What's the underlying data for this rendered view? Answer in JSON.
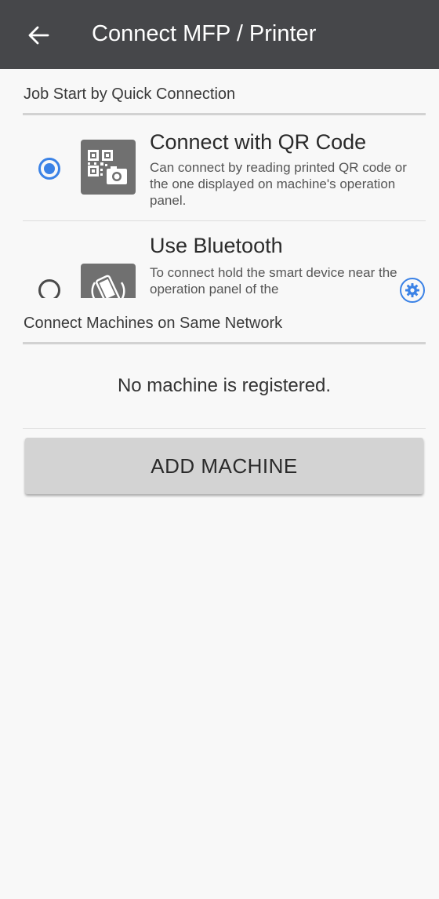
{
  "app_bar": {
    "title": "Connect MFP / Printer",
    "back_icon": "arrow-left-icon"
  },
  "quick_connection": {
    "header": "Job Start by Quick Connection",
    "options": [
      {
        "title": "Connect with QR Code",
        "description": "Can connect by reading printed QR code or the one displayed on machine's operation panel.",
        "icon": "qr-code-camera-icon",
        "selected": true
      },
      {
        "title": "Use Bluetooth",
        "description": "To connect hold the smart device near the operation panel of the",
        "icon": "phone-wireless-icon",
        "selected": false
      }
    ],
    "settings_icon": "gear-icon"
  },
  "same_network": {
    "header": "Connect Machines on Same Network",
    "empty_message": "No machine is registered.",
    "add_button_label": "ADD MACHINE"
  },
  "colors": {
    "app_bar": "#46474a",
    "accent": "#3b82e6",
    "background": "#f8f8f8",
    "button": "#d3d3d3"
  }
}
